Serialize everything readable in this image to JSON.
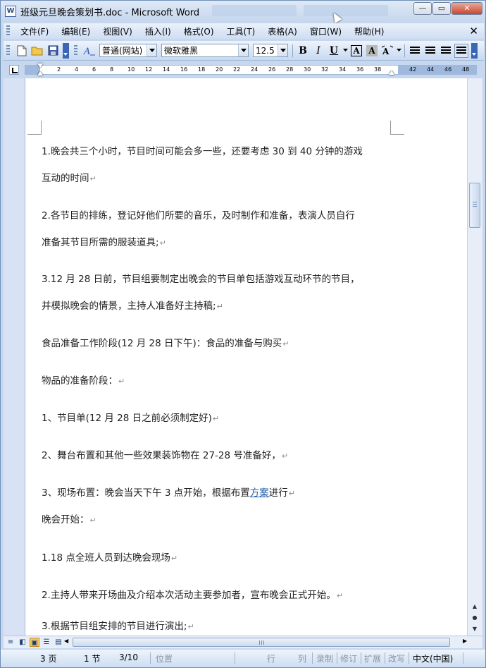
{
  "window": {
    "title": "班级元旦晚会策划书.doc - Microsoft Word",
    "icon": "word-doc-icon"
  },
  "menu": {
    "items": [
      "文件(F)",
      "编辑(E)",
      "视图(V)",
      "插入(I)",
      "格式(O)",
      "工具(T)",
      "表格(A)",
      "窗口(W)",
      "帮助(H)"
    ],
    "close": "✕"
  },
  "toolbar": {
    "style": "普通(网站)",
    "font": "微软雅黑",
    "size": "12.5",
    "bold": "B",
    "italic": "I",
    "underline": "U",
    "border_a": "A",
    "shade_a": "A"
  },
  "ruler": {
    "ticks": [
      "2",
      "4",
      "6",
      "8",
      "10",
      "12",
      "14",
      "16",
      "18",
      "20",
      "22",
      "24",
      "26",
      "28",
      "30",
      "32",
      "34",
      "36",
      "38",
      "42",
      "44",
      "46",
      "48"
    ]
  },
  "document": {
    "paragraphs": [
      {
        "text": "1.晚会共三个小时，节目时间可能会多一些，还要考虑 30 到 40 分钟的游戏"
      },
      {
        "text": "互动的时间",
        "mark": "↵"
      },
      {
        "text": "2.各节目的排练，登记好他们所要的音乐，及时制作和准备，表演人员自行"
      },
      {
        "text": "准备其节目所需的服装道具;",
        "mark": "↵"
      },
      {
        "text": "3.12 月 28 日前，节目组要制定出晚会的节目单包括游戏互动环节的节目，"
      },
      {
        "text": "并模拟晚会的情景，主持人准备好主持稿;",
        "mark": "↵"
      },
      {
        "text": "食品准备工作阶段(12 月 28 日下午)：食品的准备与购买",
        "mark": "↵"
      },
      {
        "text": "物品的准备阶段：",
        "mark": "↵"
      },
      {
        "text": "1、节目单(12 月 28 日之前必须制定好)",
        "mark": "↵"
      },
      {
        "text": "2、舞台布置和其他一些效果装饰物在 27-28 号准备好，",
        "mark": "↵"
      },
      {
        "text": "3、现场布置：晚会当天下午 3 点开始，根据布置",
        "link": "方案",
        "after": "进行",
        "mark": "↵"
      },
      {
        "text": "晚会开始：",
        "mark": "↵"
      },
      {
        "text": "1.18 点全班人员到达晚会现场",
        "mark": "↵"
      },
      {
        "text": "2.主持人带来开场曲及介绍本次活动主要参加者，宣布晚会正式开始。",
        "mark": "↵"
      },
      {
        "text": "3.根据节目组安排的节目进行演出;",
        "mark": "↵"
      }
    ]
  },
  "status": {
    "page": "3 页",
    "section": "1 节",
    "pages": "3/10",
    "position": "位置",
    "line": "行",
    "column": "列",
    "record": "录制",
    "revise": "修订",
    "extend": "扩展",
    "overtype": "改写",
    "language": "中文(中国)"
  }
}
